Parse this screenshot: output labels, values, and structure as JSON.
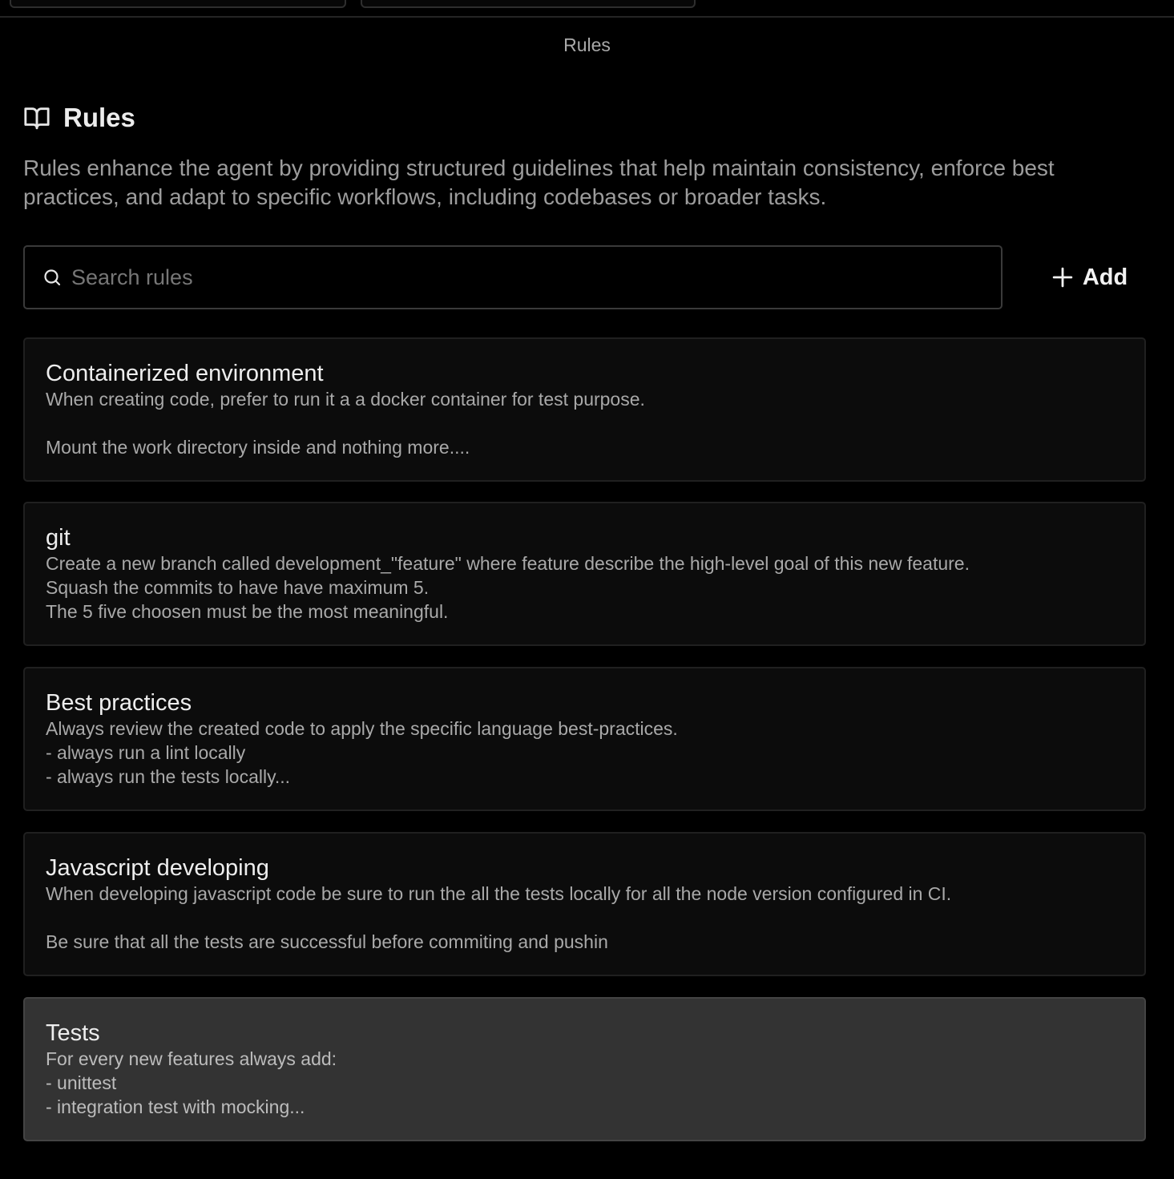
{
  "view": {
    "title": "Rules"
  },
  "header": {
    "icon": "book-open-icon",
    "title": "Rules"
  },
  "description": "Rules enhance the agent by providing structured guidelines that help maintain consistency, enforce best practices, and adapt to specific workflows, including codebases or broader tasks.",
  "search": {
    "icon": "search-icon",
    "placeholder": "Search rules",
    "value": ""
  },
  "add_button": {
    "icon": "plus-icon",
    "label": "Add"
  },
  "rules": [
    {
      "title": "Containerized environment",
      "body": "When creating code, prefer to run it a a docker container for test purpose.\n\nMount the work directory inside and nothing more....",
      "selected": false
    },
    {
      "title": "git",
      "body": "Create a new branch called development_\"feature\" where feature describe the high-level goal of this new feature.\nSquash the commits to have have maximum 5.\nThe 5 five choosen must be the most meaningful.",
      "selected": false
    },
    {
      "title": "Best practices",
      "body": "Always review the created code to apply the specific language best-practices.\n- always run a lint locally\n- always run the tests locally...",
      "selected": false
    },
    {
      "title": "Javascript developing",
      "body": "When developing javascript code be sure to run the all the tests locally for all the node version configured in CI.\n\nBe sure that all the tests are successful before commiting and pushin",
      "selected": false
    },
    {
      "title": "Tests",
      "body": "For every new features always add:\n- unittest\n- integration test with mocking...",
      "selected": true
    }
  ],
  "colors": {
    "background": "#000000",
    "card": "#0c0c0c",
    "card_selected": "#333333",
    "muted_text": "#a9a9a9"
  }
}
